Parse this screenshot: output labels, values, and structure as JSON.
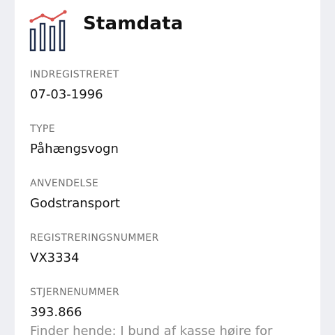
{
  "header": {
    "title": "Stamdata",
    "icon": "bar-chart-trend-icon",
    "colors": {
      "bars": "#1f2d4a",
      "trend": "#d9534f"
    }
  },
  "fields": [
    {
      "label": "INDREGISTRERET",
      "value": "07-03-1996"
    },
    {
      "label": "TYPE",
      "value": "Påhængsvogn"
    },
    {
      "label": "ANVENDELSE",
      "value": "Godstransport"
    },
    {
      "label": "REGISTRERINGSNUMMER",
      "value": "VX3334"
    },
    {
      "label": "STJERNENUMMER",
      "value": "393.866"
    }
  ],
  "note": "Finder hende: I bund af kasse højre for"
}
